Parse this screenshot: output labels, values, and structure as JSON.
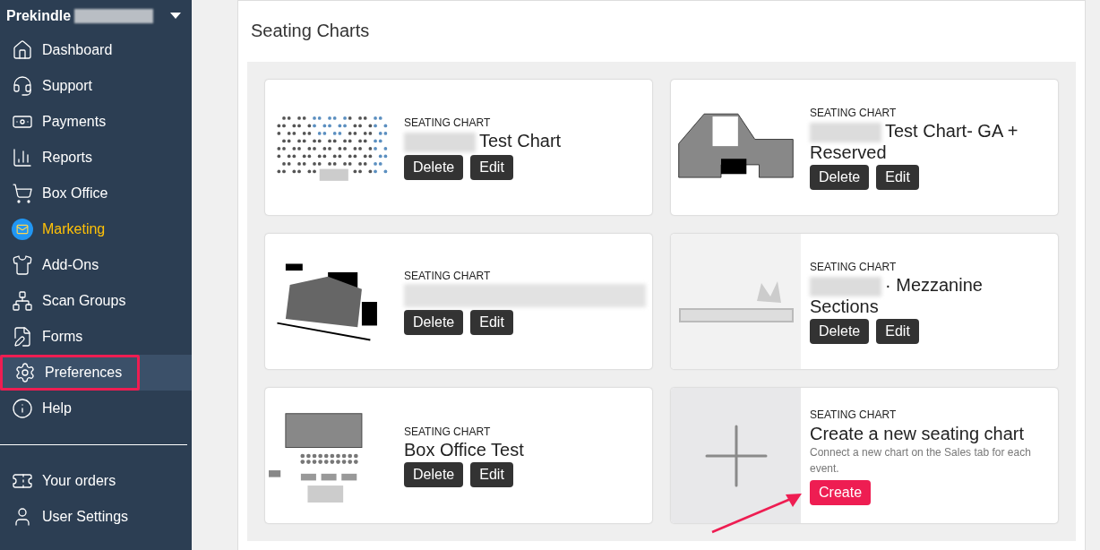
{
  "sidebar": {
    "account": {
      "name": "Prekindle",
      "redacted": true
    },
    "items": [
      {
        "label": "Dashboard",
        "selected": false,
        "highlighted": false,
        "accent": false
      },
      {
        "label": "Support",
        "selected": false,
        "highlighted": false,
        "accent": false
      },
      {
        "label": "Payments",
        "selected": false,
        "highlighted": false,
        "accent": false
      },
      {
        "label": "Reports",
        "selected": false,
        "highlighted": false,
        "accent": false
      },
      {
        "label": "Box Office",
        "selected": false,
        "highlighted": false,
        "accent": false
      },
      {
        "label": "Marketing",
        "selected": false,
        "highlighted": false,
        "accent": true
      },
      {
        "label": "Add-Ons",
        "selected": false,
        "highlighted": false,
        "accent": false
      },
      {
        "label": "Scan Groups",
        "selected": false,
        "highlighted": false,
        "accent": false
      },
      {
        "label": "Forms",
        "selected": false,
        "highlighted": false,
        "accent": false
      },
      {
        "label": "Preferences",
        "selected": true,
        "highlighted": true,
        "accent": false
      },
      {
        "label": "Help",
        "selected": false,
        "highlighted": false,
        "accent": false
      }
    ],
    "bottom_items": [
      {
        "label": "Your orders"
      },
      {
        "label": "User Settings"
      }
    ]
  },
  "panel": {
    "title": "Seating Charts",
    "cards": [
      {
        "kind": "chart",
        "label": "SEATING CHART",
        "title": "Test Chart",
        "redacted": true,
        "buttons": [
          "Delete",
          "Edit"
        ]
      },
      {
        "kind": "chart",
        "label": "SEATING CHART",
        "title": "Test Chart- GA + Reserved",
        "redacted": true,
        "buttons": [
          "Delete",
          "Edit"
        ]
      },
      {
        "kind": "chart",
        "label": "SEATING CHART",
        "redacted": true,
        "buttons": [
          "Delete",
          "Edit"
        ]
      },
      {
        "kind": "chart",
        "label": "SEATING CHART",
        "title": "· Mezzanine Sections",
        "redacted": true,
        "buttons": [
          "Delete",
          "Edit"
        ]
      },
      {
        "kind": "chart",
        "label": "SEATING CHART",
        "title": "Box Office Test",
        "redacted": false,
        "buttons": [
          "Delete",
          "Edit"
        ]
      },
      {
        "kind": "create",
        "label": "SEATING CHART",
        "title": "Create a new seating chart",
        "description": "Connect a new chart on the Sales tab for each event.",
        "button": "Create",
        "pointer_arrow": true
      }
    ]
  }
}
